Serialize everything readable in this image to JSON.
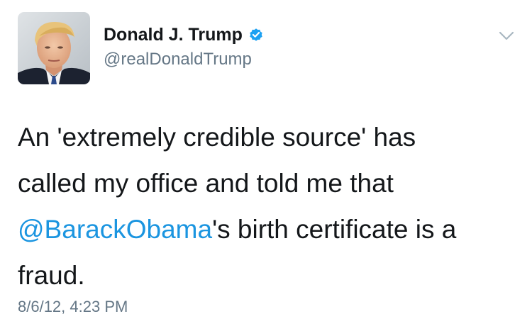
{
  "author": {
    "display_name": "Donald J. Trump",
    "username": "@realDonaldTrump",
    "verified": true
  },
  "tweet": {
    "lines": [
      "An 'extremely credible source' has",
      "called my office and told me that"
    ],
    "mention": "@BarackObama",
    "line3_rest": "'s birth certificate is a",
    "line4": "fraud."
  },
  "timestamp": "8/6/12, 4:23 PM",
  "colors": {
    "link": "#1b95e0",
    "verified_badge": "#1da1f2",
    "secondary_text": "#657786",
    "primary_text": "#14171a"
  },
  "icons": {
    "avatar": "profile-photo",
    "verified": "verified-badge-icon",
    "menu": "chevron-down-icon"
  }
}
